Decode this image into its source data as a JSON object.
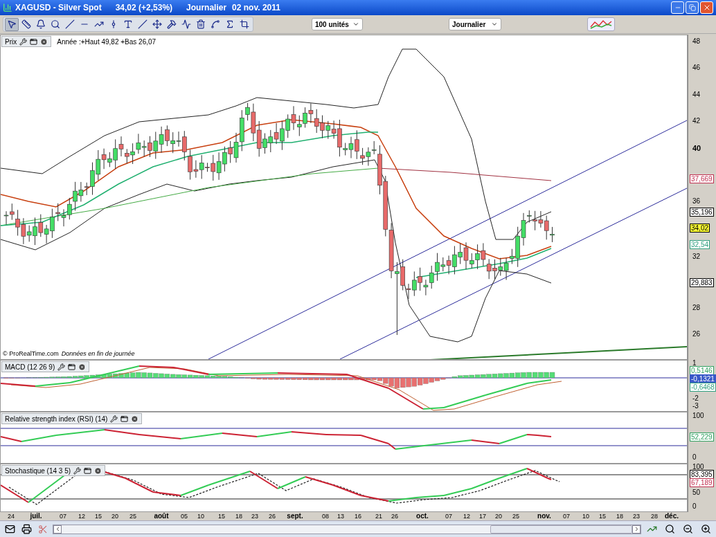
{
  "window": {
    "symbol": "XAGUSD - Silver Spot",
    "quote": "34,02 (+2,53%)",
    "period": "Journalier",
    "date": "02 nov. 2011"
  },
  "toolbar": {
    "tools": [
      {
        "selected": true
      },
      {
        "selected": false
      },
      {
        "selected": false
      },
      {
        "selected": false
      },
      {
        "selected": false
      },
      {
        "selected": false
      },
      {
        "selected": false
      },
      {
        "selected": false
      },
      {
        "selected": false
      },
      {
        "selected": false
      },
      {
        "selected": false
      },
      {
        "selected": false
      },
      {
        "selected": false
      },
      {
        "selected": false
      },
      {
        "selected": false
      },
      {
        "selected": false
      },
      {
        "selected": false
      }
    ],
    "units_dropdown": {
      "value": "100 unités"
    },
    "period_dropdown": {
      "value": "Journalier"
    }
  },
  "price_pane": {
    "title": "Prix",
    "info": "Année :+Haut 49,82 +Bas 26,07",
    "copyright": "© ProRealTime.com",
    "note": "Données en fin de journée",
    "y_ticks": [
      "48",
      "46",
      "44",
      "42",
      "40",
      "36",
      "32",
      "28",
      "26"
    ],
    "tags": [
      {
        "text": "37,669",
        "kind": "plain",
        "color": "#c03050"
      },
      {
        "text": "35,196",
        "kind": "plain",
        "color": "#000000"
      },
      {
        "text": "34,02",
        "kind": "current",
        "color": "#000000"
      },
      {
        "text": "32,54",
        "kind": "plain",
        "color": "#30a080"
      },
      {
        "text": "29,883",
        "kind": "plain",
        "color": "#000000"
      }
    ]
  },
  "macd_pane": {
    "title": "MACD (12 26 9)",
    "y_ticks": [
      "1",
      "-2",
      "-3"
    ],
    "tags": [
      {
        "text": "0,5146",
        "kind": "plain",
        "color": "#30a060"
      },
      {
        "text": "-0,1321",
        "kind": "highlight",
        "color": "#3858c8"
      },
      {
        "text": "-0,6468",
        "kind": "plain",
        "color": "#30a080"
      }
    ]
  },
  "rsi_pane": {
    "title": "Relative strength index (RSI) (14)",
    "y_ticks": [
      "100",
      "0"
    ],
    "tags": [
      {
        "text": "52,229",
        "kind": "plain",
        "color": "#30a060"
      }
    ]
  },
  "stoch_pane": {
    "title": "Stochastique (14 3 5)",
    "y_ticks": [
      "100",
      "50",
      "0"
    ],
    "tags": [
      {
        "text": "83,395",
        "kind": "plain",
        "color": "#000000"
      },
      {
        "text": "67,189",
        "kind": "plain",
        "color": "#c03050"
      }
    ]
  },
  "x_axis": [
    {
      "text": "24",
      "kind": "day"
    },
    {
      "text": "juil.",
      "kind": "month"
    },
    {
      "text": "07",
      "kind": "day"
    },
    {
      "text": "12",
      "kind": "day"
    },
    {
      "text": "15",
      "kind": "day"
    },
    {
      "text": "20",
      "kind": "day"
    },
    {
      "text": "25",
      "kind": "day"
    },
    {
      "text": "août",
      "kind": "month"
    },
    {
      "text": "05",
      "kind": "day"
    },
    {
      "text": "10",
      "kind": "day"
    },
    {
      "text": "15",
      "kind": "day"
    },
    {
      "text": "18",
      "kind": "day"
    },
    {
      "text": "23",
      "kind": "day"
    },
    {
      "text": "26",
      "kind": "day"
    },
    {
      "text": "sept.",
      "kind": "month"
    },
    {
      "text": "08",
      "kind": "day"
    },
    {
      "text": "13",
      "kind": "day"
    },
    {
      "text": "16",
      "kind": "day"
    },
    {
      "text": "21",
      "kind": "day"
    },
    {
      "text": "26",
      "kind": "day"
    },
    {
      "text": "oct.",
      "kind": "month"
    },
    {
      "text": "07",
      "kind": "day"
    },
    {
      "text": "12",
      "kind": "day"
    },
    {
      "text": "17",
      "kind": "day"
    },
    {
      "text": "20",
      "kind": "day"
    },
    {
      "text": "25",
      "kind": "day"
    },
    {
      "text": "nov.",
      "kind": "month"
    },
    {
      "text": "07",
      "kind": "day"
    },
    {
      "text": "10",
      "kind": "day"
    },
    {
      "text": "15",
      "kind": "day"
    },
    {
      "text": "18",
      "kind": "day"
    },
    {
      "text": "23",
      "kind": "day"
    },
    {
      "text": "28",
      "kind": "day"
    },
    {
      "text": "déc.",
      "kind": "month"
    }
  ]
}
